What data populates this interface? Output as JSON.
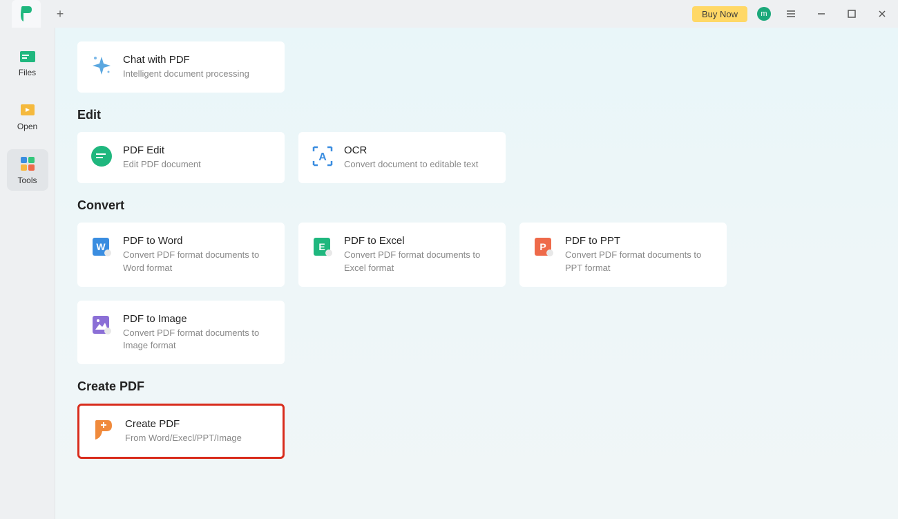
{
  "titlebar": {
    "buy_now": "Buy Now",
    "avatar_letter": "m"
  },
  "sidebar": {
    "files": "Files",
    "open": "Open",
    "tools": "Tools"
  },
  "sections": {
    "chat": {
      "title": "Chat with PDF",
      "sub": "Intelligent document processing"
    },
    "edit_heading": "Edit",
    "pdf_edit": {
      "title": "PDF Edit",
      "sub": "Edit PDF document"
    },
    "ocr": {
      "title": "OCR",
      "sub": "Convert document to editable text"
    },
    "convert_heading": "Convert",
    "to_word": {
      "title": "PDF to Word",
      "sub": "Convert PDF format documents to Word format"
    },
    "to_excel": {
      "title": "PDF to Excel",
      "sub": "Convert PDF format documents to Excel format"
    },
    "to_ppt": {
      "title": "PDF to PPT",
      "sub": "Convert PDF format documents to PPT format"
    },
    "to_image": {
      "title": "PDF to Image",
      "sub": "Convert PDF format documents to Image format"
    },
    "create_heading": "Create PDF",
    "create_pdf": {
      "title": "Create PDF",
      "sub": "From Word/Execl/PPT/Image"
    }
  }
}
